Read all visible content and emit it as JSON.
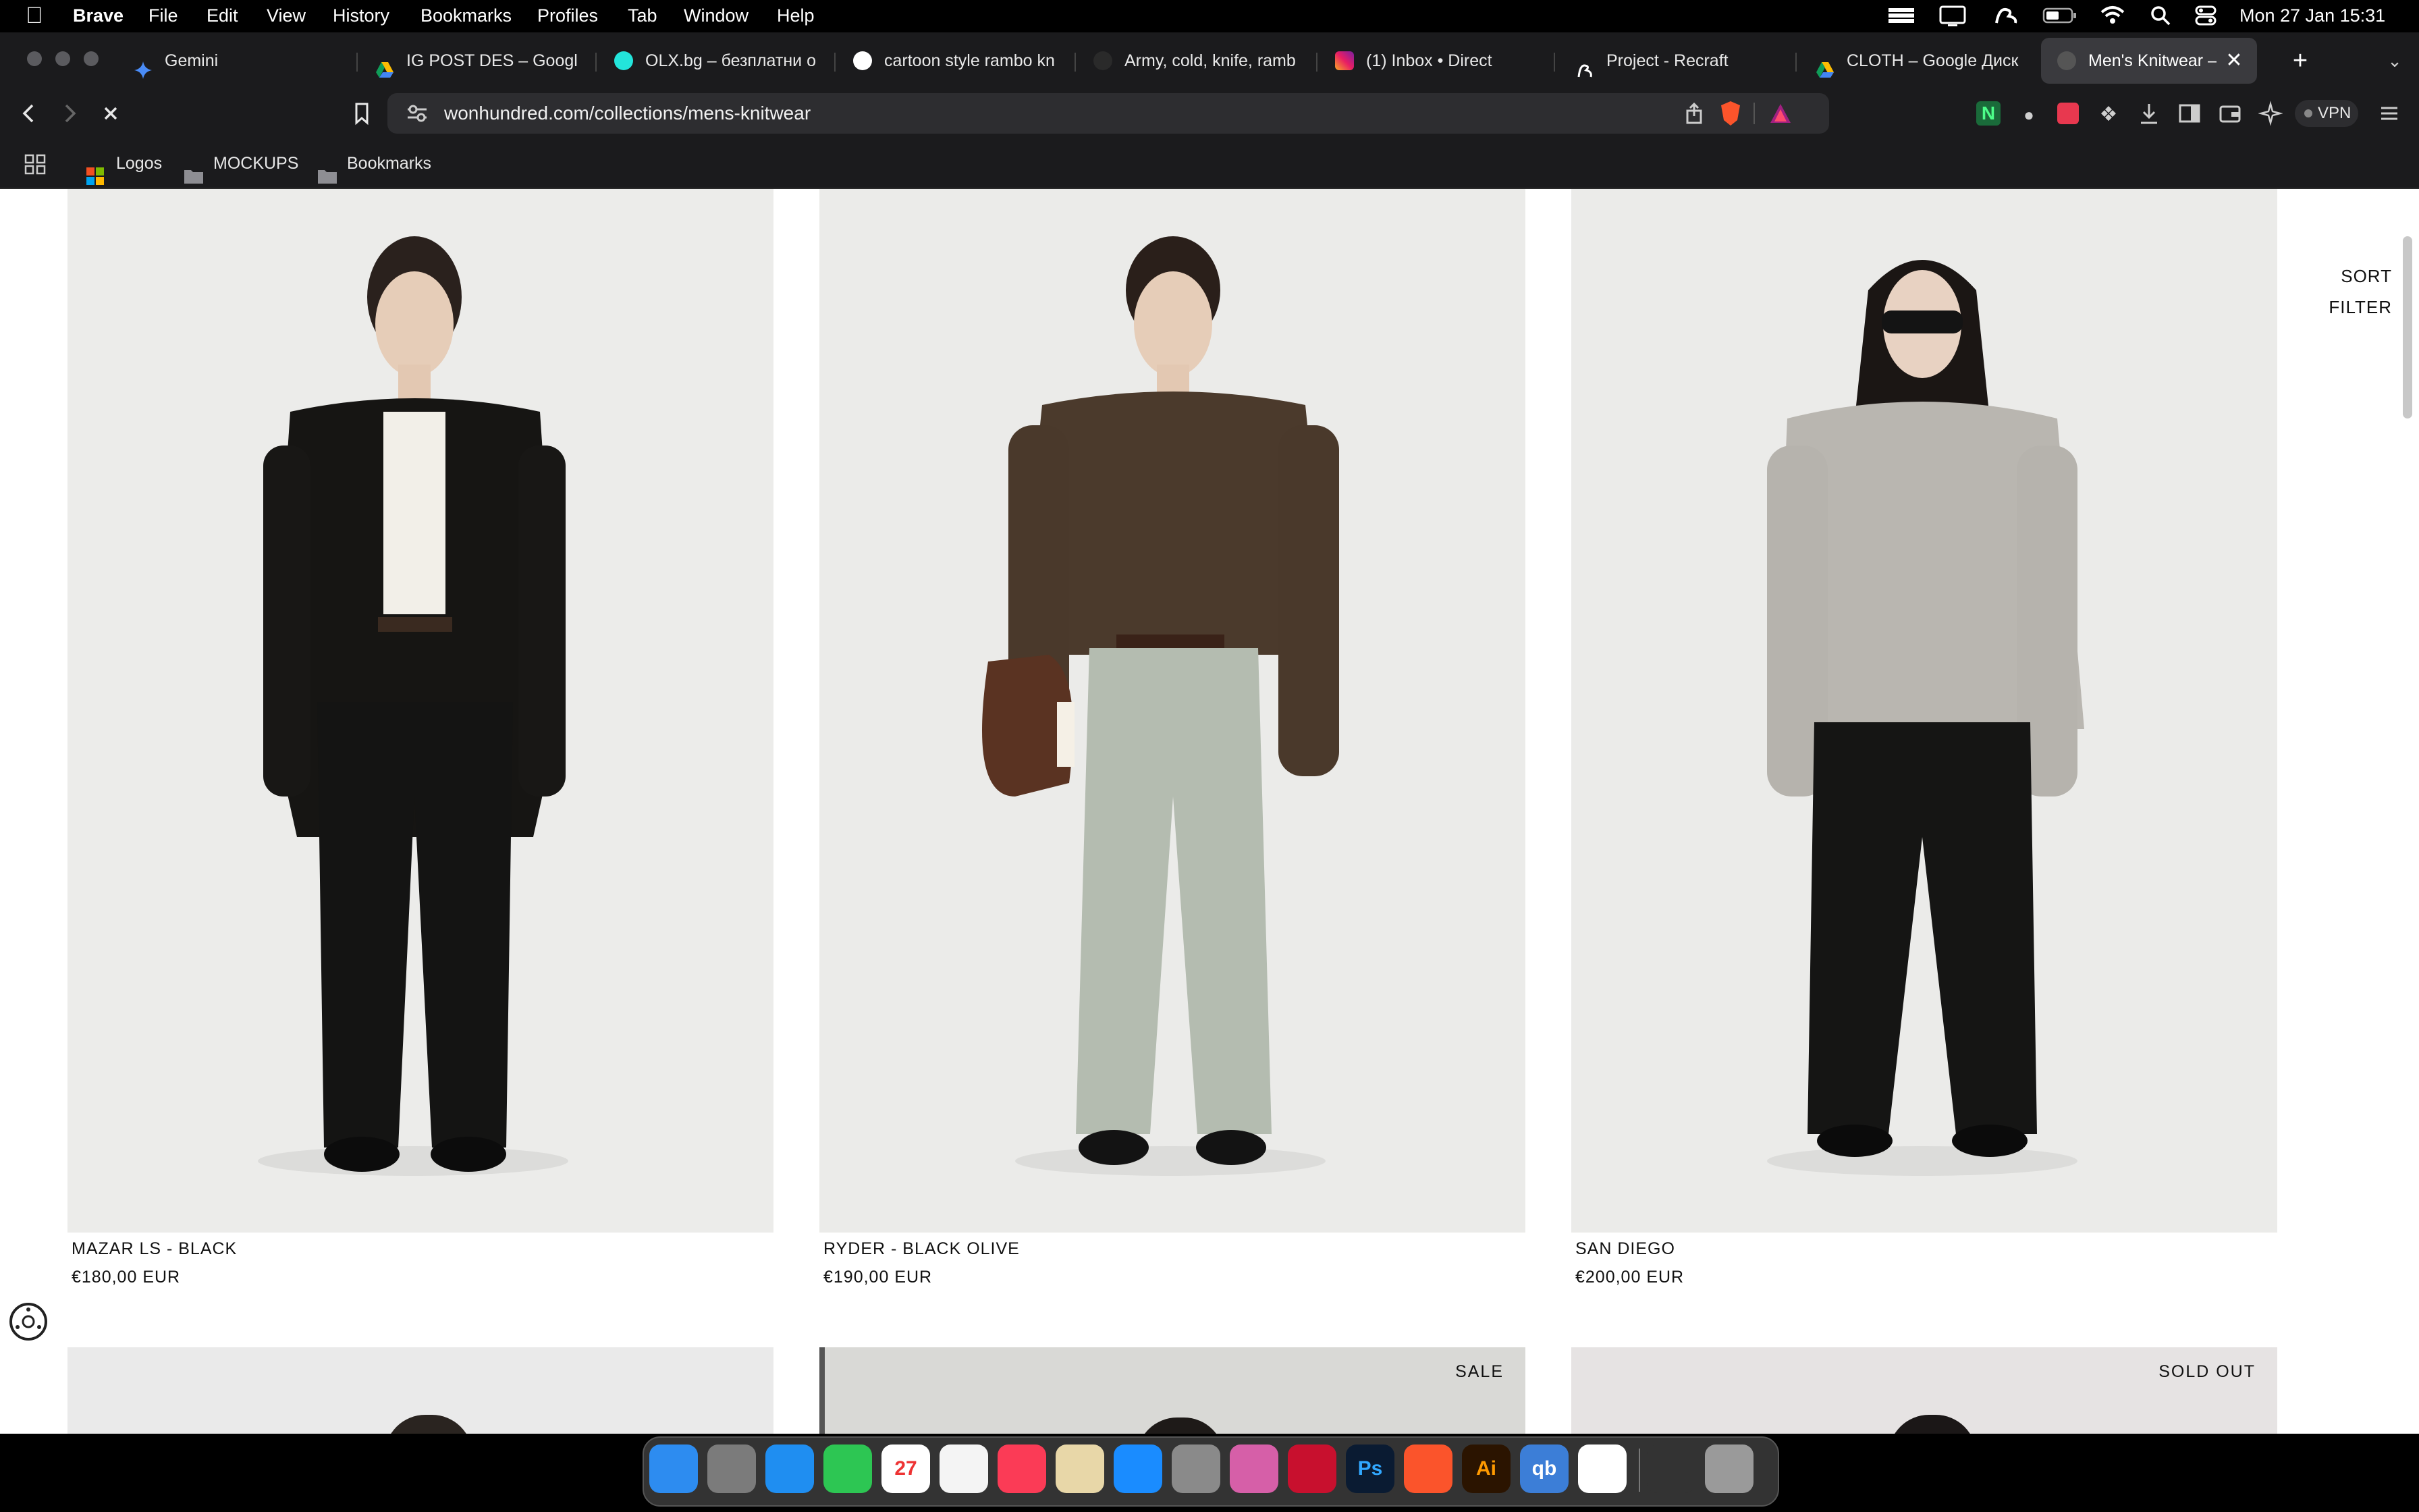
{
  "menubar": {
    "app_name": "Brave",
    "menus": [
      "File",
      "Edit",
      "View",
      "History",
      "Bookmarks",
      "Profiles",
      "Tab",
      "Window",
      "Help"
    ],
    "datetime": "Mon 27 Jan  15:31"
  },
  "tabs": [
    {
      "title": "Gemini",
      "icon": "gemini-icon"
    },
    {
      "title": "IG POST DES – Google",
      "icon": "google-drive-icon"
    },
    {
      "title": "OLX.bg – безплатни о",
      "icon": "olx-icon"
    },
    {
      "title": "cartoon style rambo kn",
      "icon": "google-icon"
    },
    {
      "title": "Army, cold, knife, ramb",
      "icon": "site-icon"
    },
    {
      "title": "(1) Inbox • Direct",
      "icon": "instagram-icon"
    },
    {
      "title": "Project - Recraft",
      "icon": "recraft-icon"
    },
    {
      "title": "CLOTH – Google Диск",
      "icon": "google-drive-icon"
    },
    {
      "title": "Men's Knitwear – ",
      "icon": "site-icon",
      "active": true
    }
  ],
  "toolbar": {
    "url": "wonhundred.com/collections/mens-knitwear",
    "vpn_label": "VPN"
  },
  "bookmarks_bar": {
    "items": [
      "Logos",
      "MOCKUPS",
      "Bookmarks"
    ]
  },
  "page": {
    "sort_label": "SORT",
    "filter_label": "FILTER",
    "products": [
      {
        "name": "MAZAR LS - BLACK",
        "price": "€180,00 EUR"
      },
      {
        "name": "RYDER - BLACK OLIVE",
        "price": "€190,00 EUR"
      },
      {
        "name": "SAN DIEGO",
        "price": "€200,00 EUR"
      }
    ],
    "next_row_badges": [
      "",
      "SALE",
      "SOLD OUT"
    ]
  },
  "dock": {
    "apps": [
      {
        "name": "finder-icon",
        "color": "#2d8cf0",
        "label": ""
      },
      {
        "name": "launchpad-icon",
        "color": "#7b7b7b",
        "label": ""
      },
      {
        "name": "safari-icon",
        "color": "#1f8ef1",
        "label": ""
      },
      {
        "name": "facetime-icon",
        "color": "#2dc653",
        "label": ""
      },
      {
        "name": "calendar-icon",
        "color": "#ffffff",
        "label": "27"
      },
      {
        "name": "reminders-icon",
        "color": "#f4f4f4",
        "label": ""
      },
      {
        "name": "music-icon",
        "color": "#fb3b56",
        "label": ""
      },
      {
        "name": "preview-icon",
        "color": "#e8d7a8",
        "label": ""
      },
      {
        "name": "app-store-icon",
        "color": "#1a8cff",
        "label": ""
      },
      {
        "name": "system-settings-icon",
        "color": "#8a8a8a",
        "label": ""
      },
      {
        "name": "photo-app-icon",
        "color": "#d65fa8",
        "label": ""
      },
      {
        "name": "aperture-app-icon",
        "color": "#c8102e",
        "label": ""
      },
      {
        "name": "photoshop-icon",
        "color": "#0a1b32",
        "label": "Ps"
      },
      {
        "name": "brave-icon",
        "color": "#fb542b",
        "label": ""
      },
      {
        "name": "illustrator-icon",
        "color": "#2b1400",
        "label": "Ai"
      },
      {
        "name": "qbittorrent-icon",
        "color": "#3c7ed7",
        "label": "qb"
      },
      {
        "name": "freeform-icon",
        "color": "#ffffff",
        "label": ""
      },
      {
        "name": "screen-window-icon",
        "color": "#333333",
        "label": ""
      },
      {
        "name": "trash-icon",
        "color": "#9a9a9a",
        "label": ""
      }
    ]
  }
}
